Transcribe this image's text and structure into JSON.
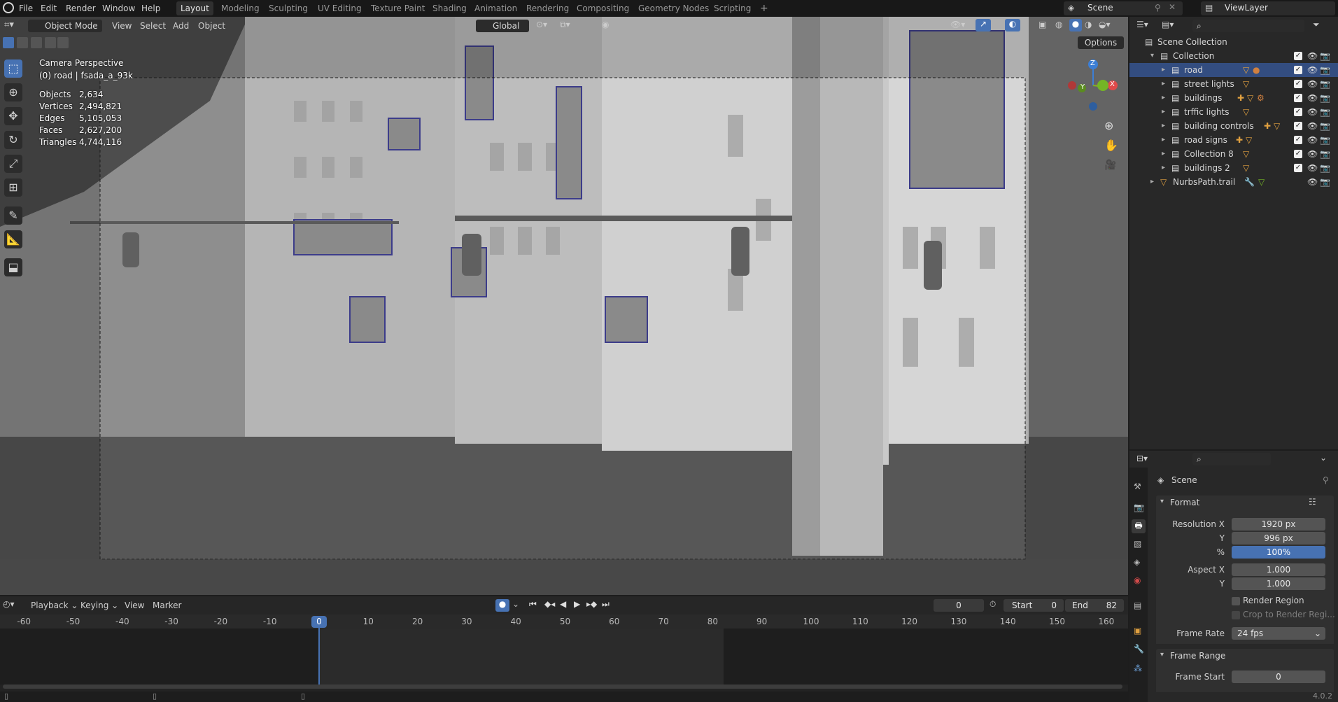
{
  "topbar": {
    "menus": [
      "File",
      "Edit",
      "Render",
      "Window",
      "Help"
    ],
    "workspaces": [
      "Layout",
      "Modeling",
      "Sculpting",
      "UV Editing",
      "Texture Paint",
      "Shading",
      "Animation",
      "Rendering",
      "Compositing",
      "Geometry Nodes",
      "Scripting"
    ],
    "active_workspace": "Layout",
    "add_tab": "+",
    "scene_name": "Scene",
    "view_layer": "ViewLayer"
  },
  "viewport_header": {
    "mode": "Object Mode",
    "menus": [
      "View",
      "Select",
      "Add",
      "Object"
    ],
    "transform_orientation": "Global",
    "options_label": "Options"
  },
  "viewport": {
    "camera_label": "Camera Perspective",
    "object_label": "(0) road | fsada_a_93k",
    "stats": [
      {
        "label": "Objects",
        "value": "2,634"
      },
      {
        "label": "Vertices",
        "value": "2,494,821"
      },
      {
        "label": "Edges",
        "value": "5,105,053"
      },
      {
        "label": "Faces",
        "value": "2,627,200"
      },
      {
        "label": "Triangles",
        "value": "4,744,116"
      }
    ],
    "gizmo": {
      "x": "X",
      "y": "Y",
      "z": "Z"
    }
  },
  "outliner": {
    "root": "Scene Collection",
    "collection": "Collection",
    "items": [
      {
        "label": "road",
        "selected": true
      },
      {
        "label": "street lights",
        "selected": false
      },
      {
        "label": "buildings",
        "selected": false
      },
      {
        "label": "trffic lights",
        "selected": false
      },
      {
        "label": "building controls",
        "selected": false
      },
      {
        "label": "road signs",
        "selected": false
      },
      {
        "label": "Collection 8",
        "selected": false
      },
      {
        "label": "buildings 2",
        "selected": false
      }
    ],
    "extra": "NurbsPath.trail"
  },
  "properties": {
    "scene_label": "Scene",
    "format_panel": "Format",
    "resolution_x_label": "Resolution X",
    "resolution_x": "1920 px",
    "resolution_y_label": "Y",
    "resolution_y": "996 px",
    "percent_label": "%",
    "percent": "100%",
    "aspect_x_label": "Aspect X",
    "aspect_x": "1.000",
    "aspect_y_label": "Y",
    "aspect_y": "1.000",
    "render_region": "Render Region",
    "crop_region": "Crop to Render Regi...",
    "frame_rate_label": "Frame Rate",
    "frame_rate": "24 fps",
    "frame_range_panel": "Frame Range",
    "frame_start_label": "Frame Start",
    "frame_start": "0",
    "version": "4.0.2"
  },
  "timeline": {
    "menus": [
      "Playback",
      "Keying",
      "View",
      "Marker"
    ],
    "current_frame": "0",
    "start_label": "Start",
    "start": "0",
    "end_label": "End",
    "end": "82",
    "playhead": "0",
    "ticks": [
      "-60",
      "-50",
      "-40",
      "-30",
      "-20",
      "-10",
      "10",
      "20",
      "30",
      "40",
      "50",
      "60",
      "70",
      "80",
      "90",
      "100",
      "110",
      "120",
      "130",
      "140",
      "150",
      "160"
    ]
  },
  "colors": {
    "accent": "#4772b3",
    "selection": "#334d80",
    "x_axis": "#e04a4a",
    "y_axis": "#74b526",
    "z_axis": "#3c7fd6"
  }
}
